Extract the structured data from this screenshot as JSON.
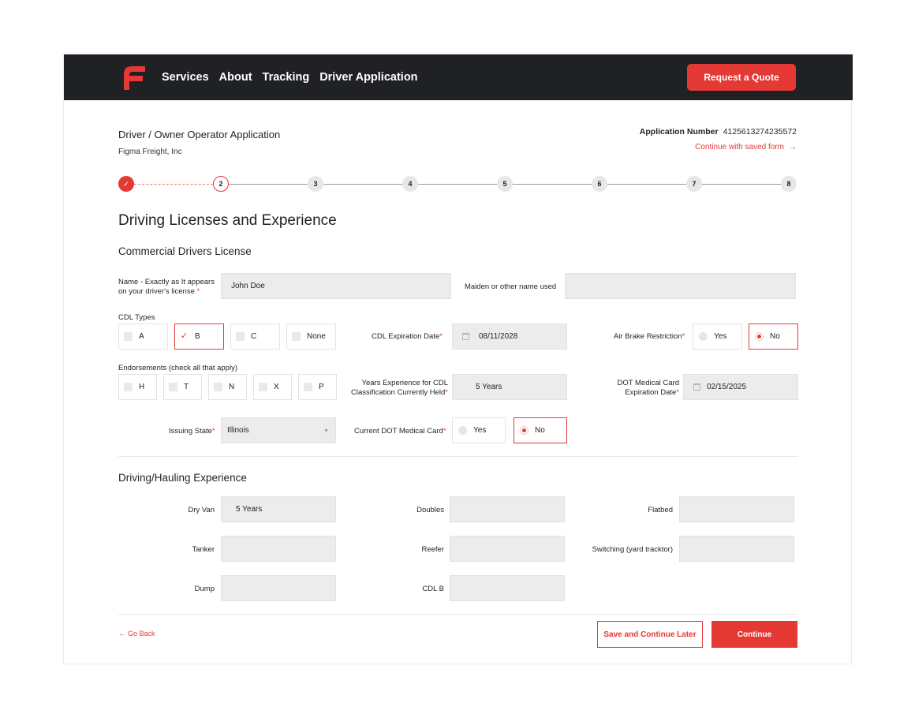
{
  "nav": {
    "logo_icon": "figma-freight-logo",
    "items": [
      "Services",
      "About",
      "Tracking",
      "Driver Application"
    ],
    "cta": "Request a Quote"
  },
  "header": {
    "title": "Driver / Owner Operator Application",
    "company": "Figma Freight, Inc",
    "app_number_label": "Application Number",
    "app_number": "4125613274235572",
    "continue_saved": "Continue with saved form",
    "continue_saved_icon": "arrow-right-icon"
  },
  "stepper": {
    "steps": [
      "1",
      "2",
      "3",
      "4",
      "5",
      "6",
      "7",
      "8"
    ],
    "completed": 1,
    "current": 2
  },
  "section": {
    "title": "Driving Licenses and Experience",
    "cdl_heading": "Commercial Drivers License",
    "exp_heading": "Driving/Hauling Experience"
  },
  "cdl": {
    "name_label": "Name - Exactly as It appears on your driver's license",
    "name_value": "John Doe",
    "maiden_label": "Maiden or other name used",
    "maiden_value": "",
    "types_label": "CDL Types",
    "types": [
      {
        "label": "A",
        "checked": false
      },
      {
        "label": "B",
        "checked": true
      },
      {
        "label": "C",
        "checked": false
      },
      {
        "label": "None",
        "checked": false
      }
    ],
    "expiration_label": "CDL Expiration Date",
    "expiration_value": "08/11/2028",
    "air_brake_label": "Air Brake Restriction",
    "air_brake_options": [
      "Yes",
      "No"
    ],
    "air_brake_selected": "No",
    "endorsements_label": "Endorsements (check all that apply)",
    "endorsements": [
      "H",
      "T",
      "N",
      "X",
      "P"
    ],
    "years_exp_label": "Years Experience for CDL Classification Currently Held",
    "years_exp_value": "5 Years",
    "dot_exp_label": "DOT Medical Card Expiration Date",
    "dot_exp_value": "02/15/2025",
    "issuing_state_label": "Issuing State",
    "issuing_state_value": "Illinois",
    "dot_card_label": "Current DOT Medical Card",
    "dot_card_options": [
      "Yes",
      "No"
    ],
    "dot_card_selected": "No"
  },
  "experience": {
    "fields": [
      {
        "label": "Dry Van",
        "value": "5 Years"
      },
      {
        "label": "Doubles",
        "value": ""
      },
      {
        "label": "Flatbed",
        "value": ""
      },
      {
        "label": "Tanker",
        "value": ""
      },
      {
        "label": "Reefer",
        "value": ""
      },
      {
        "label": "Switching (yard tracktor)",
        "value": ""
      },
      {
        "label": "Dump",
        "value": ""
      },
      {
        "label": "CDL B",
        "value": ""
      }
    ]
  },
  "footer": {
    "go_back": "Go Back",
    "save_later": "Save and Continue Later",
    "continue": "Continue"
  },
  "colors": {
    "accent": "#e53935",
    "nav_bg": "#1f2124",
    "field_bg": "#ececec"
  }
}
